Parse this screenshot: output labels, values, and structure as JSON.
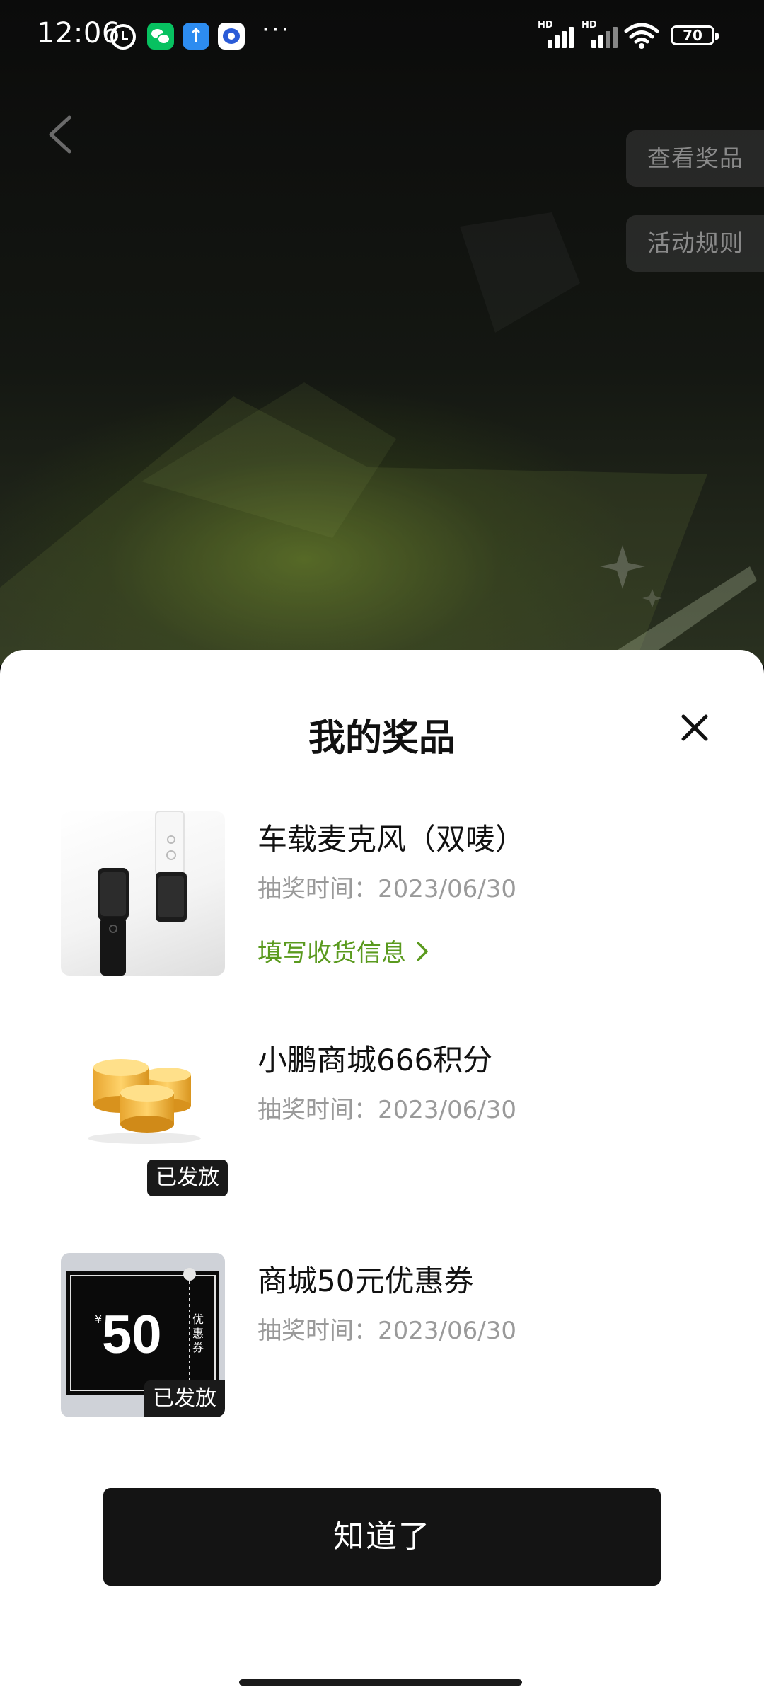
{
  "status_bar": {
    "time": "12:06",
    "signal_label": "HD",
    "battery": "70"
  },
  "header": {
    "view_prizes_label": "查看奖品",
    "rules_label": "活动规则"
  },
  "modal": {
    "title": "我的奖品",
    "date_label": "抽奖时间：",
    "prizes": [
      {
        "name": "车载麦克风（双唛）",
        "date": "2023/06/30",
        "action_label": "填写收货信息"
      },
      {
        "name": "小鹏商城666积分",
        "date": "2023/06/30",
        "badge": "已发放"
      },
      {
        "name": "商城50元优惠券",
        "date": "2023/06/30",
        "badge": "已发放",
        "coupon": {
          "currency": "¥",
          "amount": "50",
          "side_text": "优惠券"
        }
      }
    ],
    "confirm_label": "知道了"
  },
  "colors": {
    "accent_green": "#5a9a1e",
    "button_dark": "#141414",
    "muted_text": "#9a9a9a"
  }
}
